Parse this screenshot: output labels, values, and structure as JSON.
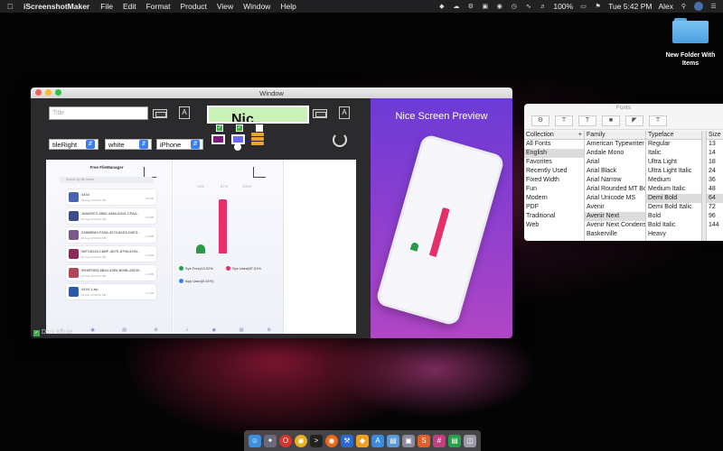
{
  "menubar": {
    "app_name": "iScreenshotMaker",
    "menus": [
      "File",
      "Edit",
      "Format",
      "Product",
      "View",
      "Window",
      "Help"
    ],
    "battery": "100%",
    "clock": "Tue 5:42 PM",
    "user": "Alex"
  },
  "desktop": {
    "folder_label": "New Folder With Items"
  },
  "window": {
    "title": "Window",
    "title_placeholder": "Title",
    "preview_text": "Nic",
    "selects": {
      "layout": "tileRight",
      "color": "white",
      "device": "iPhone"
    },
    "dark_mode_label": "Dark Mode",
    "promo_title": "Nice Screen Preview",
    "file_manager": {
      "title": "Free FileManager",
      "search_placeholder": "Search by file name",
      "rows": [
        {
          "name": "4444",
          "date": "30 Aug 19 06:34 PM",
          "size": "4.8 KB"
        },
        {
          "name": "16A05972-0562-4468-A015-CFAA...",
          "date": "30 Aug 19 06:34 PM",
          "size": "1.5 MB"
        },
        {
          "name": "23865BA0-F63A-4070-84D3-D0E3...",
          "date": "30 Aug 19 06:34 PM",
          "size": "1.9 MB"
        },
        {
          "name": "96F13D26-C8BF-4D7E-8796-5294...",
          "date": "30 Aug 19 06:34 PM",
          "size": "1.4 MB"
        },
        {
          "name": "9906FDB3-6B54-43E6-B09B-43639...",
          "date": "30 Aug 19 06:34 PM",
          "size": "1.4 MB"
        },
        {
          "name": "4444 1.zip",
          "date": "30 Aug 19 06:34 PM",
          "size": "2.4 KB"
        }
      ]
    },
    "storage": {
      "pcts": [
        "13%",
        "87%",
        "100%"
      ],
      "sys_free": "Sys Free(13.02%",
      "sys_used": "Sys Used(87.01%",
      "app_used": "App Used(0.01%)"
    }
  },
  "fonts_panel": {
    "title": "Fonts",
    "headers": [
      "Collection",
      "Family",
      "Typeface",
      "Size"
    ],
    "collections": [
      "All Fonts",
      "English",
      "Favorites",
      "Recently Used",
      "Fixed Width",
      "Fun",
      "Modern",
      "PDF",
      "Traditional",
      "Web"
    ],
    "families": [
      "American Typewriter",
      "Andale Mono",
      "Arial",
      "Arial Black",
      "Arial Narrow",
      "Arial Rounded MT Bold",
      "Arial Unicode MS",
      "Avenir",
      "Avenir Next",
      "Avenir Next Condensed",
      "Baskerville"
    ],
    "typefaces": [
      "Regular",
      "Italic",
      "Ultra Light",
      "Ultra Light Italic",
      "Medium",
      "Medium Italic",
      "Demi Bold",
      "Demi Bold Italic",
      "Bold",
      "Bold Italic",
      "Heavy"
    ],
    "sizes": [
      "13",
      "14",
      "18",
      "24",
      "36",
      "48",
      "64",
      "72",
      "96",
      "144"
    ],
    "selected_collection": "English",
    "selected_family": "Avenir Next",
    "selected_typeface": "Demi Bold",
    "selected_size": "64"
  },
  "colors": {
    "promo_purple": "#8a3ed0",
    "preview_green": "#c9f2b9",
    "bar_pink": "#e6306a",
    "check_green": "#3bb04a"
  }
}
